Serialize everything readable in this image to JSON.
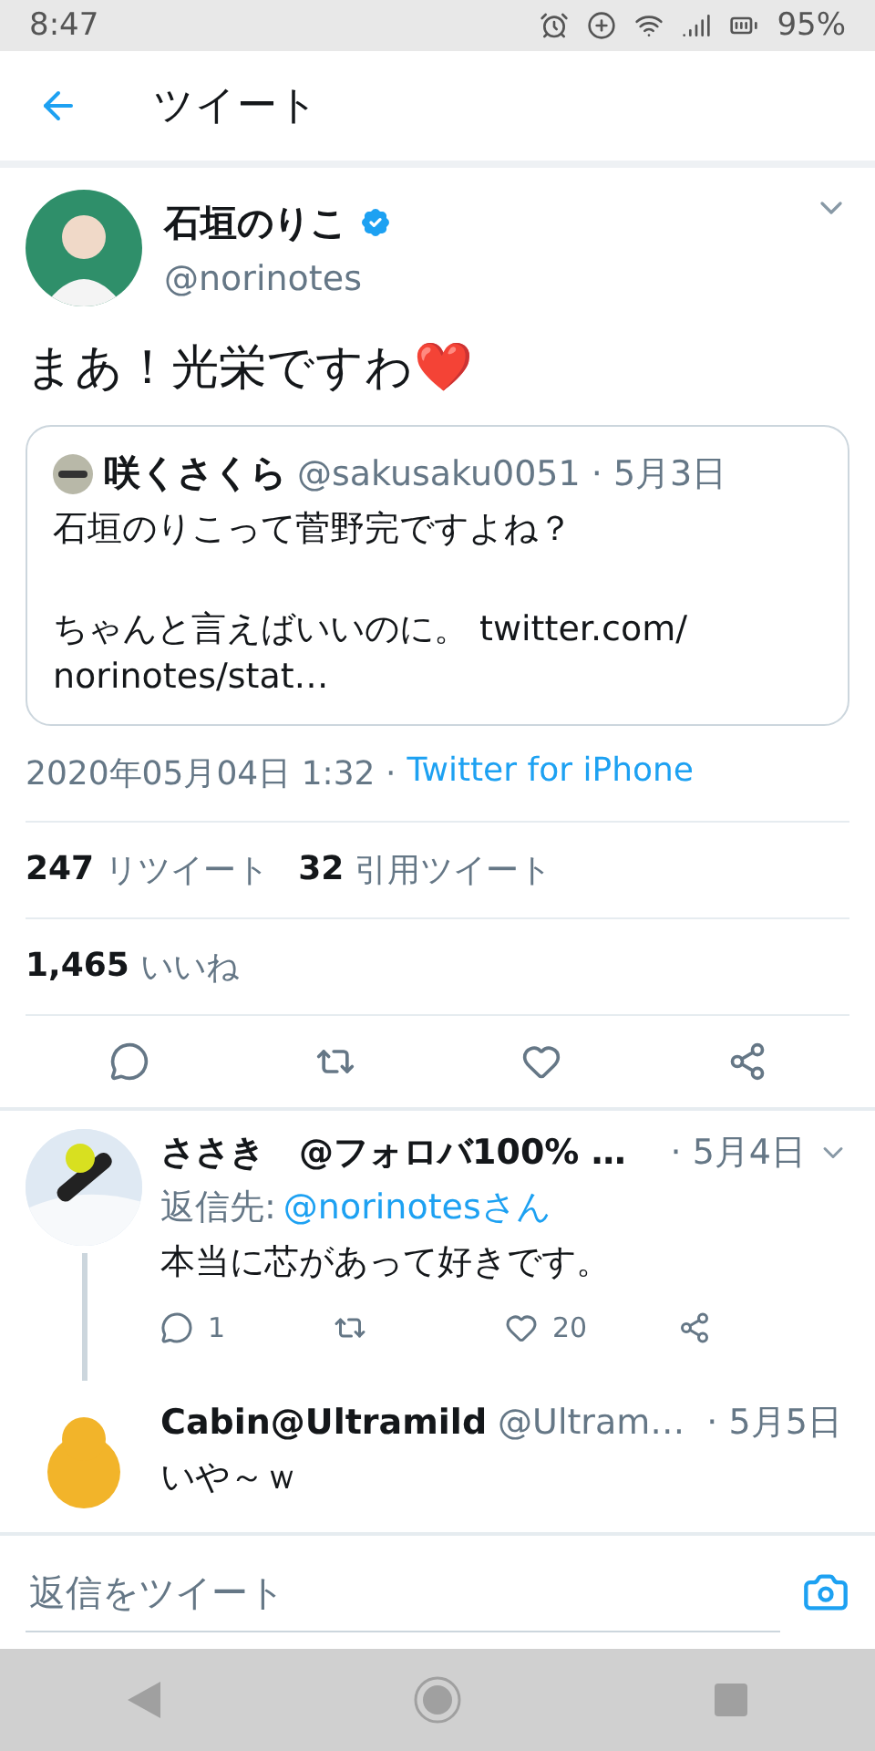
{
  "status_bar": {
    "time": "8:47",
    "battery": "95%"
  },
  "header": {
    "title": "ツイート"
  },
  "tweet": {
    "name": "石垣のりこ",
    "verified": true,
    "handle": "@norinotes",
    "text": "まあ！光栄ですわ❤️",
    "quote": {
      "name": "咲くさくら",
      "handle": "@sakusaku0051",
      "date": "· 5月3日",
      "lines": [
        "石垣のりこって菅野完ですよね？",
        "ちゃんと言えばいいのに。 twitter.com/norinotes/stat…"
      ]
    },
    "timestamp": "2020年05月04日 1:32 ·",
    "source": "Twitter for iPhone",
    "stats": [
      {
        "count": "247",
        "label": "リツイート"
      },
      {
        "count": "32",
        "label": "引用ツイート"
      }
    ],
    "likes": {
      "count": "1,465",
      "label": "いいね"
    }
  },
  "replies": [
    {
      "name": "ささき　@フォロバ100% …",
      "date": "· 5月4日",
      "reply_label": "返信先:",
      "reply_handle": "@norinotesさん",
      "text": "本当に芯があって好きです。",
      "reply_count": "1",
      "like_count": "20"
    },
    {
      "name": "Cabin@Ultramild",
      "handle": "@Ultram…",
      "date": "· 5月5日",
      "text": "いや～ｗ"
    }
  ],
  "composer": {
    "placeholder": "返信をツイート"
  }
}
